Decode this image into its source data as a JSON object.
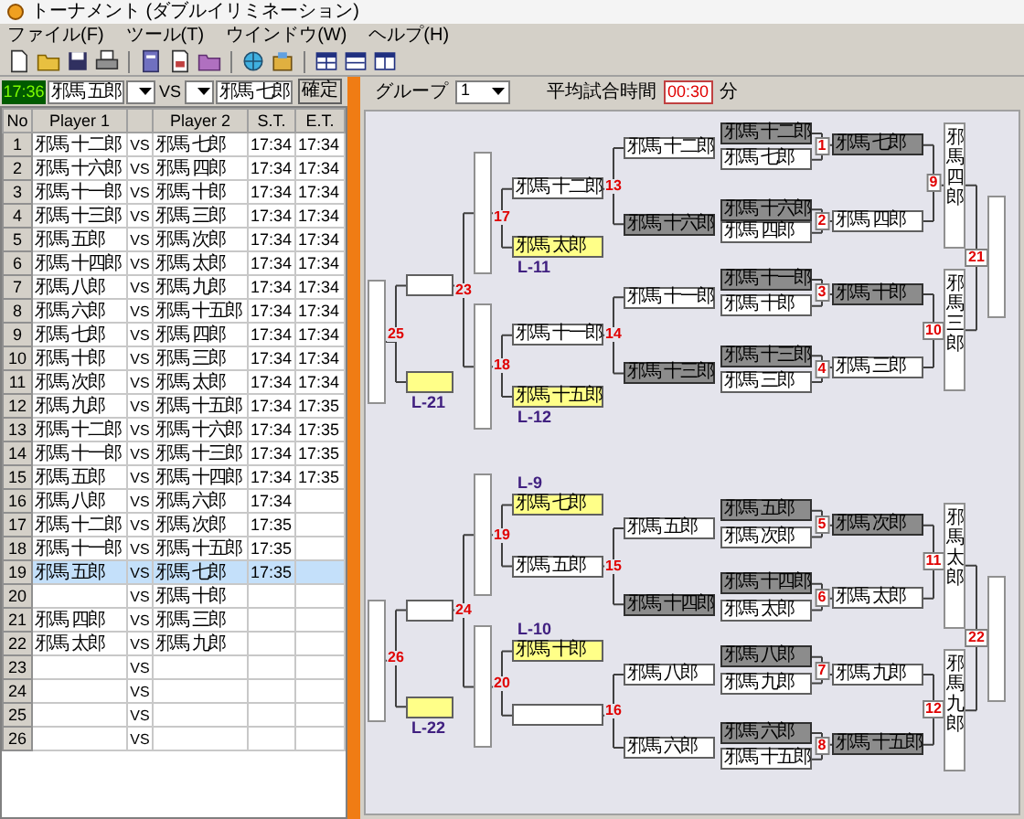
{
  "window": {
    "title": "トーナメント (ダブルイリミネーション)"
  },
  "menu": [
    "ファイル(F)",
    "ツール(T)",
    "ウインドウ(W)",
    "ヘルプ(H)"
  ],
  "entry_bar": {
    "time": "17:36",
    "player1": "邪馬 五郎",
    "vs": "VS",
    "player2": "邪馬 七郎",
    "button": "確定"
  },
  "table": {
    "columns": [
      "No",
      "Player 1",
      "Player 2",
      "S.T.",
      "E.T."
    ],
    "rows": [
      {
        "no": "1",
        "player1": "邪馬 十二郎",
        "vs": "VS",
        "player2": "邪馬 七郎",
        "start": "17:34",
        "end": "17:34",
        "selected": false
      },
      {
        "no": "2",
        "player1": "邪馬 十六郎",
        "vs": "VS",
        "player2": "邪馬 四郎",
        "start": "17:34",
        "end": "17:34",
        "selected": false
      },
      {
        "no": "3",
        "player1": "邪馬 十一郎",
        "vs": "VS",
        "player2": "邪馬 十郎",
        "start": "17:34",
        "end": "17:34",
        "selected": false
      },
      {
        "no": "4",
        "player1": "邪馬 十三郎",
        "vs": "VS",
        "player2": "邪馬 三郎",
        "start": "17:34",
        "end": "17:34",
        "selected": false
      },
      {
        "no": "5",
        "player1": "邪馬 五郎",
        "vs": "VS",
        "player2": "邪馬 次郎",
        "start": "17:34",
        "end": "17:34",
        "selected": false
      },
      {
        "no": "6",
        "player1": "邪馬 十四郎",
        "vs": "VS",
        "player2": "邪馬 太郎",
        "start": "17:34",
        "end": "17:34",
        "selected": false
      },
      {
        "no": "7",
        "player1": "邪馬 八郎",
        "vs": "VS",
        "player2": "邪馬 九郎",
        "start": "17:34",
        "end": "17:34",
        "selected": false
      },
      {
        "no": "8",
        "player1": "邪馬 六郎",
        "vs": "VS",
        "player2": "邪馬 十五郎",
        "start": "17:34",
        "end": "17:34",
        "selected": false
      },
      {
        "no": "9",
        "player1": "邪馬 七郎",
        "vs": "VS",
        "player2": "邪馬 四郎",
        "start": "17:34",
        "end": "17:34",
        "selected": false
      },
      {
        "no": "10",
        "player1": "邪馬 十郎",
        "vs": "VS",
        "player2": "邪馬 三郎",
        "start": "17:34",
        "end": "17:34",
        "selected": false
      },
      {
        "no": "11",
        "player1": "邪馬 次郎",
        "vs": "VS",
        "player2": "邪馬 太郎",
        "start": "17:34",
        "end": "17:34",
        "selected": false
      },
      {
        "no": "12",
        "player1": "邪馬 九郎",
        "vs": "VS",
        "player2": "邪馬 十五郎",
        "start": "17:34",
        "end": "17:35",
        "selected": false
      },
      {
        "no": "13",
        "player1": "邪馬 十二郎",
        "vs": "VS",
        "player2": "邪馬 十六郎",
        "start": "17:34",
        "end": "17:35",
        "selected": false
      },
      {
        "no": "14",
        "player1": "邪馬 十一郎",
        "vs": "VS",
        "player2": "邪馬 十三郎",
        "start": "17:34",
        "end": "17:35",
        "selected": false
      },
      {
        "no": "15",
        "player1": "邪馬 五郎",
        "vs": "VS",
        "player2": "邪馬 十四郎",
        "start": "17:34",
        "end": "17:35",
        "selected": false
      },
      {
        "no": "16",
        "player1": "邪馬 八郎",
        "vs": "VS",
        "player2": "邪馬 六郎",
        "start": "17:34",
        "selected": false
      },
      {
        "no": "17",
        "player1": "邪馬 十二郎",
        "vs": "VS",
        "player2": "邪馬 次郎",
        "start": "17:35",
        "selected": false
      },
      {
        "no": "18",
        "player1": "邪馬 十一郎",
        "vs": "VS",
        "player2": "邪馬 十五郎",
        "start": "17:35",
        "selected": false
      },
      {
        "no": "19",
        "player1": "邪馬 五郎",
        "vs": "VS",
        "player2": "邪馬 七郎",
        "start": "17:35",
        "selected": true
      },
      {
        "no": "20",
        "vs": "VS",
        "player2": "邪馬 十郎",
        "selected": false
      },
      {
        "no": "21",
        "player1": "邪馬 四郎",
        "vs": "VS",
        "player2": "邪馬 三郎",
        "selected": false
      },
      {
        "no": "22",
        "player1": "邪馬 太郎",
        "vs": "VS",
        "player2": "邪馬 九郎",
        "selected": false
      },
      {
        "no": "23",
        "vs": "VS",
        "selected": false
      },
      {
        "no": "24",
        "vs": "VS",
        "selected": false
      },
      {
        "no": "25",
        "vs": "VS",
        "selected": false
      },
      {
        "no": "26",
        "vs": "VS",
        "selected": false
      }
    ]
  },
  "options": {
    "group_label": "グループ",
    "group": "1",
    "time_label": "平均試合時間",
    "time": "00:30",
    "unit": "分"
  },
  "bracket": {
    "slots": [
      {
        "kind": "dark",
        "name": "邪馬 十二郎"
      },
      {
        "kind": "white",
        "name": "邪馬 七郎"
      },
      {
        "kind": "dark",
        "name": "邪馬 七郎"
      },
      {
        "kind": "dark",
        "name": "邪馬 十六郎"
      },
      {
        "kind": "white",
        "name": "邪馬 四郎"
      },
      {
        "kind": "white",
        "name": "邪馬 四郎"
      },
      {
        "kind": "tall",
        "name": "邪馬四郎"
      },
      {
        "kind": "dark",
        "name": "邪馬 十一郎"
      },
      {
        "kind": "white",
        "name": "邪馬 十郎"
      },
      {
        "kind": "dark",
        "name": "邪馬 十郎"
      },
      {
        "kind": "dark",
        "name": "邪馬 十三郎"
      },
      {
        "kind": "white",
        "name": "邪馬 三郎"
      },
      {
        "kind": "white",
        "name": "邪馬 三郎"
      },
      {
        "kind": "tall",
        "name": "邪馬三郎"
      },
      {
        "kind": "tall"
      },
      {
        "kind": "white",
        "name": "邪馬 十二郎"
      },
      {
        "kind": "dark",
        "name": "邪馬 十六郎"
      },
      {
        "kind": "white",
        "name": "邪馬 十二郎"
      },
      {
        "kind": "yellow",
        "name": "邪馬 太郎"
      },
      {
        "kind": "tall"
      },
      {
        "kind": "white",
        "name": "邪馬 十一郎"
      },
      {
        "kind": "dark",
        "name": "邪馬 十三郎"
      },
      {
        "kind": "white",
        "name": "邪馬 十一郎"
      },
      {
        "kind": "yellow",
        "name": "邪馬 十五郎"
      },
      {
        "kind": "tall"
      },
      {
        "kind": "white"
      },
      {
        "kind": "yellow"
      },
      {
        "kind": "tall"
      },
      {
        "kind": "dark",
        "name": "邪馬 五郎"
      },
      {
        "kind": "white",
        "name": "邪馬 次郎"
      },
      {
        "kind": "dark",
        "name": "邪馬 次郎"
      },
      {
        "kind": "dark",
        "name": "邪馬 十四郎"
      },
      {
        "kind": "white",
        "name": "邪馬 太郎"
      },
      {
        "kind": "white",
        "name": "邪馬 太郎"
      },
      {
        "kind": "tall",
        "name": "邪馬太郎"
      },
      {
        "kind": "dark",
        "name": "邪馬 八郎"
      },
      {
        "kind": "white",
        "name": "邪馬 九郎"
      },
      {
        "kind": "white",
        "name": "邪馬 九郎"
      },
      {
        "kind": "dark",
        "name": "邪馬 六郎"
      },
      {
        "kind": "white",
        "name": "邪馬 十五郎"
      },
      {
        "kind": "dark",
        "name": "邪馬 十五郎"
      },
      {
        "kind": "tall",
        "name": "邪馬九郎"
      },
      {
        "kind": "tall"
      },
      {
        "kind": "white",
        "name": "邪馬 五郎"
      },
      {
        "kind": "dark",
        "name": "邪馬 十四郎"
      },
      {
        "kind": "yellow",
        "name": "邪馬 七郎"
      },
      {
        "kind": "white",
        "name": "邪馬 五郎"
      },
      {
        "kind": "tall"
      },
      {
        "kind": "white",
        "name": "邪馬 八郎"
      },
      {
        "kind": "white",
        "name": "邪馬 六郎"
      },
      {
        "kind": "yellow",
        "name": "邪馬 十郎"
      },
      {
        "kind": "white"
      },
      {
        "kind": "tall"
      },
      {
        "kind": "white"
      },
      {
        "kind": "yellow"
      },
      {
        "kind": "tall"
      }
    ],
    "match_numbers": [
      "1",
      "2",
      "3",
      "4",
      "5",
      "6",
      "7",
      "8",
      "9",
      "10",
      "11",
      "12",
      "13",
      "14",
      "15",
      "16",
      "17",
      "18",
      "19",
      "20",
      "21",
      "22",
      "23",
      "24",
      "25",
      "26"
    ],
    "loser_labels": [
      "L-11",
      "L-12",
      "L-21",
      "L-9",
      "L-10",
      "L-22"
    ]
  }
}
